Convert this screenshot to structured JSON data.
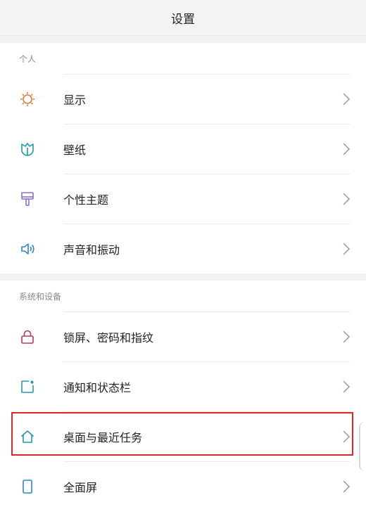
{
  "header": {
    "title": "设置"
  },
  "sections": [
    {
      "title": "个人",
      "items": [
        {
          "label": "显示",
          "icon": "display-sun-icon",
          "color": "#e07b2e"
        },
        {
          "label": "壁纸",
          "icon": "wallpaper-flower-icon",
          "color": "#1f9aa6"
        },
        {
          "label": "个性主题",
          "icon": "theme-brush-icon",
          "color": "#8b6fc8"
        },
        {
          "label": "声音和振动",
          "icon": "speaker-icon",
          "color": "#2a88c9"
        }
      ]
    },
    {
      "title": "系统和设备",
      "items": [
        {
          "label": "锁屏、密码和指纹",
          "icon": "lock-icon",
          "color": "#b43a5a"
        },
        {
          "label": "通知和状态栏",
          "icon": "notification-icon",
          "color": "#1f9aa6"
        },
        {
          "label": "桌面与最近任务",
          "icon": "home-icon",
          "color": "#1f9aa6"
        },
        {
          "label": "全面屏",
          "icon": "phone-fullscreen-icon",
          "color": "#2a88c9"
        }
      ]
    }
  ],
  "highlight_color": "#e0262b"
}
